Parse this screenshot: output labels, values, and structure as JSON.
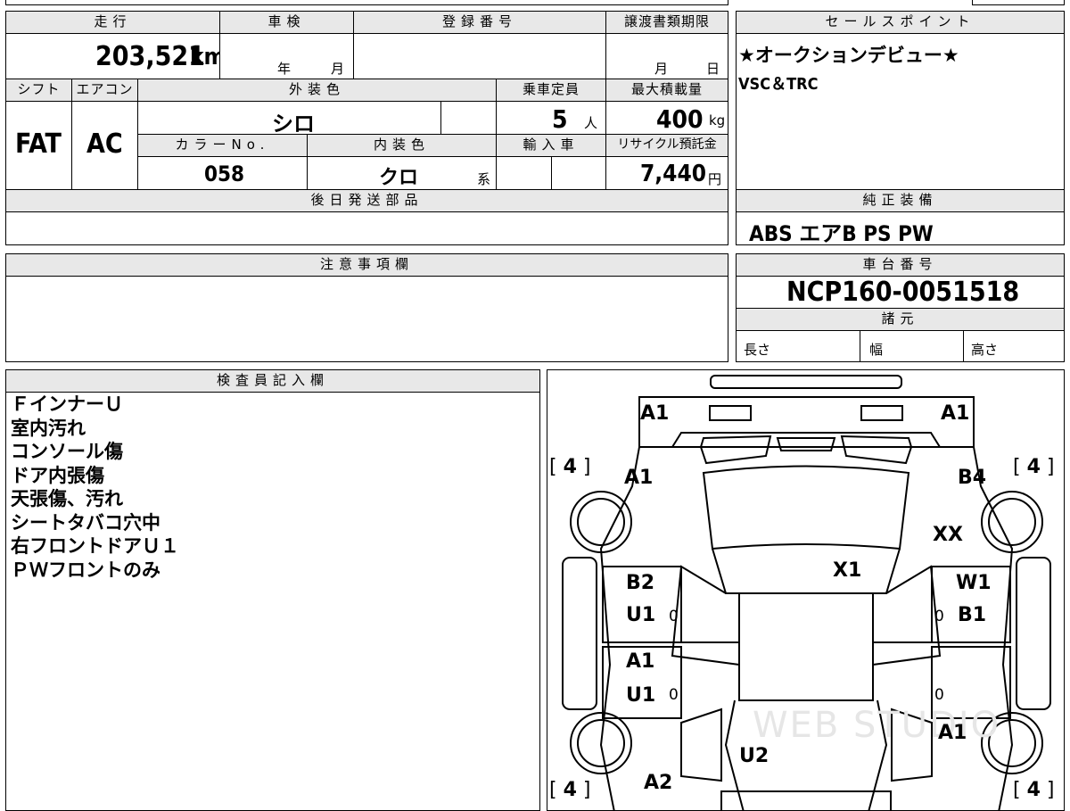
{
  "top": {
    "headers": {
      "mileage": "走行",
      "inspection": "車検",
      "registration": "登録番号",
      "transfer_deadline": "譲渡書類期限",
      "sales_point": "セールスポイント",
      "shift": "シフト",
      "aircon": "エアコン",
      "exterior_color": "外装色",
      "capacity": "乗車定員",
      "max_load": "最大積載量",
      "color_no": "カラーNo.",
      "interior_color": "内装色",
      "import": "輸入車",
      "recycle": "リサイクル預託金",
      "later_parts": "後日発送部品",
      "genuine_equipment": "純正装備",
      "caution": "注意事項欄",
      "chassis_no": "車台番号",
      "specs": "諸元",
      "inspector": "検査員記入欄"
    },
    "mileage": "203,521",
    "mileage_unit": "km",
    "inspection_year": "年",
    "inspection_month": "月",
    "transfer_month": "月",
    "transfer_day": "日",
    "shift": "FAT",
    "aircon": "AC",
    "exterior_color": "シロ",
    "capacity": "5",
    "capacity_unit": "人",
    "max_load": "400",
    "max_load_unit": "kg",
    "color_no": "058",
    "interior_color": "クロ",
    "interior_suffix": "系",
    "recycle_fee": "7,440",
    "recycle_unit": "円",
    "sales_points": [
      "★オークションデビュー★",
      "VSC＆TRC"
    ],
    "genuine_equipment": "ABS エアB PS PW",
    "chassis_no": "NCP160-0051518",
    "spec_length": "長さ",
    "spec_width": "幅",
    "spec_height": "高さ"
  },
  "inspector_notes": [
    "ＦインナーＵ",
    "室内汚れ",
    "コンソール傷",
    "ドア内張傷",
    "天張傷、汚れ",
    "シートタバコ穴中",
    "右フロントドアＵ１",
    "ＰＷフロントのみ"
  ],
  "diagram": {
    "marks": {
      "front_left": "A1",
      "front_right": "A1",
      "fender_left": "A1",
      "fender_right": "B4",
      "fender_right_2": "XX",
      "windshield": "X1",
      "front_door_left_1": "B2",
      "front_door_left_2": "U1",
      "front_door_right_1": "W1",
      "front_door_right_2": "B1",
      "rear_door_left_1": "A1",
      "rear_door_left_2": "U1",
      "quarter_right": "A1",
      "roof_rear": "U2",
      "rear_left": "A2"
    },
    "tire_front_left": "4",
    "tire_front_right": "4",
    "tire_rear_left": "4",
    "tire_rear_right": "4",
    "zero_marks": [
      "0",
      "0",
      "0",
      "0"
    ],
    "watermark": "WEB STUDIO"
  }
}
